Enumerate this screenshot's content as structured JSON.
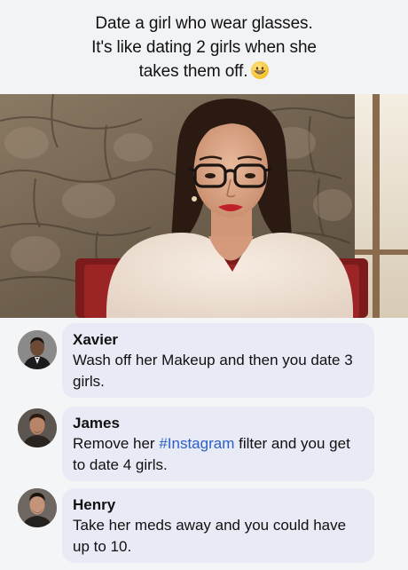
{
  "caption": {
    "line1": "Date a girl who wear glasses.",
    "line2": "It's like dating 2 girls when she",
    "line3": "takes them off.",
    "emoji": "grinning-face-emoji"
  },
  "photo": {
    "description_icon": "woman-with-glasses-photo"
  },
  "comments": [
    {
      "author": "Xavier",
      "text": "Wash off her Makeup and then you date 3 girls."
    },
    {
      "author": "James",
      "text_before": "Remove her ",
      "hashtag": "#Instagram",
      "text_after": " filter and you get to date 4 girls."
    },
    {
      "author": "Henry",
      "text": "Take her meds away and you could have up to 10."
    }
  ],
  "colors": {
    "bubble": "#e8eaf6",
    "hashtag": "#2d5fc4",
    "background": "#f0f2f5"
  }
}
